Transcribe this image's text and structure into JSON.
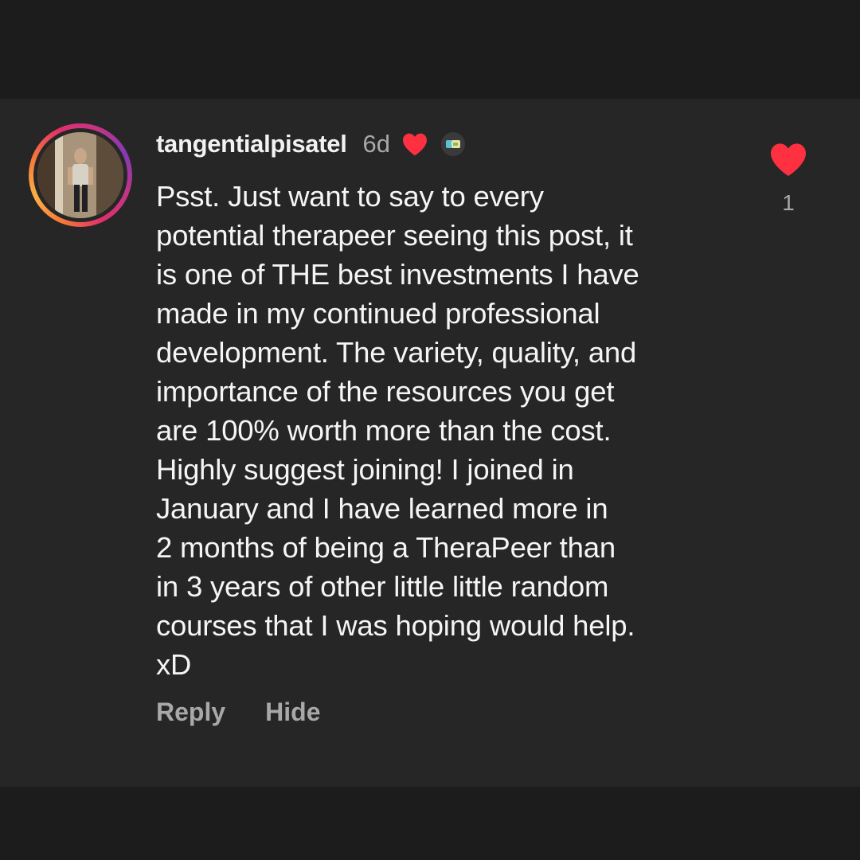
{
  "comment": {
    "username": "tangentialpisatel",
    "time_ago": "6d",
    "liked_by_creator": true,
    "text_lines": [
      "Psst. Just want to say to every",
      "potential therapeer seeing this post, it",
      "is one of THE best investments I have",
      "made in my continued professional",
      "development. The variety, quality, and",
      "importance of the resources you get",
      "are 100% worth more than the cost.",
      "Highly suggest joining! I joined in",
      "January and I have learned more in",
      "2 months of being a TheraPeer than",
      "in 3 years of other little little random",
      "courses that I was hoping would help.",
      "xD"
    ],
    "like_count": "1",
    "like_color": "#ff3040"
  },
  "actions": {
    "reply_label": "Reply",
    "hide_label": "Hide"
  },
  "icons": {
    "liked_heart": "heart-filled-icon",
    "creator_badge": "creator-avatar-badge-icon",
    "like_button": "heart-filled-icon"
  },
  "colors": {
    "background": "#1c1c1c",
    "card": "#262626",
    "text_primary": "#f5f5f5",
    "text_secondary": "#a8a8a8",
    "heart": "#ff3040"
  }
}
